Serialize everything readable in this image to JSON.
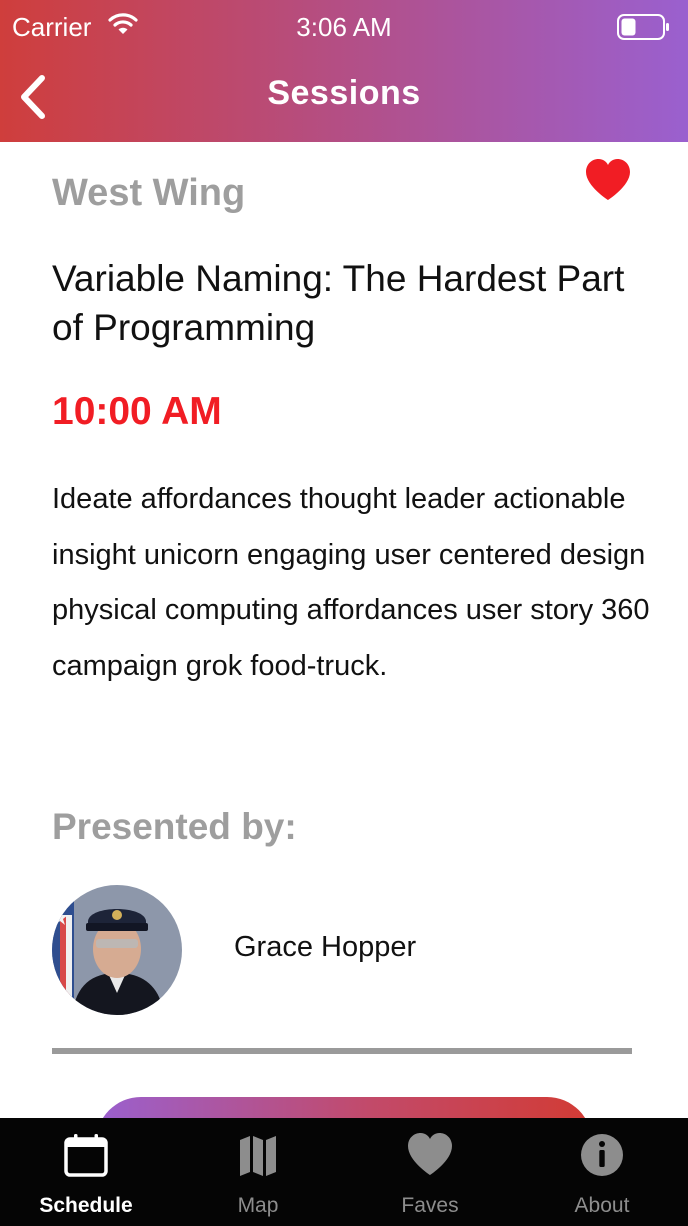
{
  "status_bar": {
    "carrier": "Carrier",
    "time": "3:06 AM"
  },
  "nav": {
    "title": "Sessions",
    "back_icon": "chevron-left-icon"
  },
  "session": {
    "location": "West Wing",
    "title": "Variable Naming: The Hardest Part of Programming",
    "time": "10:00 AM",
    "description": "Ideate affordances thought leader actionable insight unicorn engaging user centered design physical computing affordances user story 360 campaign grok food-truck.",
    "favorited": true
  },
  "presented_by_label": "Presented by:",
  "presenter": {
    "name": "Grace Hopper"
  },
  "tabs": [
    {
      "label": "Schedule",
      "icon": "calendar-icon",
      "active": true
    },
    {
      "label": "Map",
      "icon": "map-icon",
      "active": false
    },
    {
      "label": "Faves",
      "icon": "heart-icon",
      "active": false
    },
    {
      "label": "About",
      "icon": "info-icon",
      "active": false
    }
  ],
  "colors": {
    "accent_red": "#f11d24",
    "label_gray": "#9e9e9e",
    "header_start": "#cf3e3c",
    "header_end": "#9a60cf",
    "tabbar_bg": "#050505"
  }
}
